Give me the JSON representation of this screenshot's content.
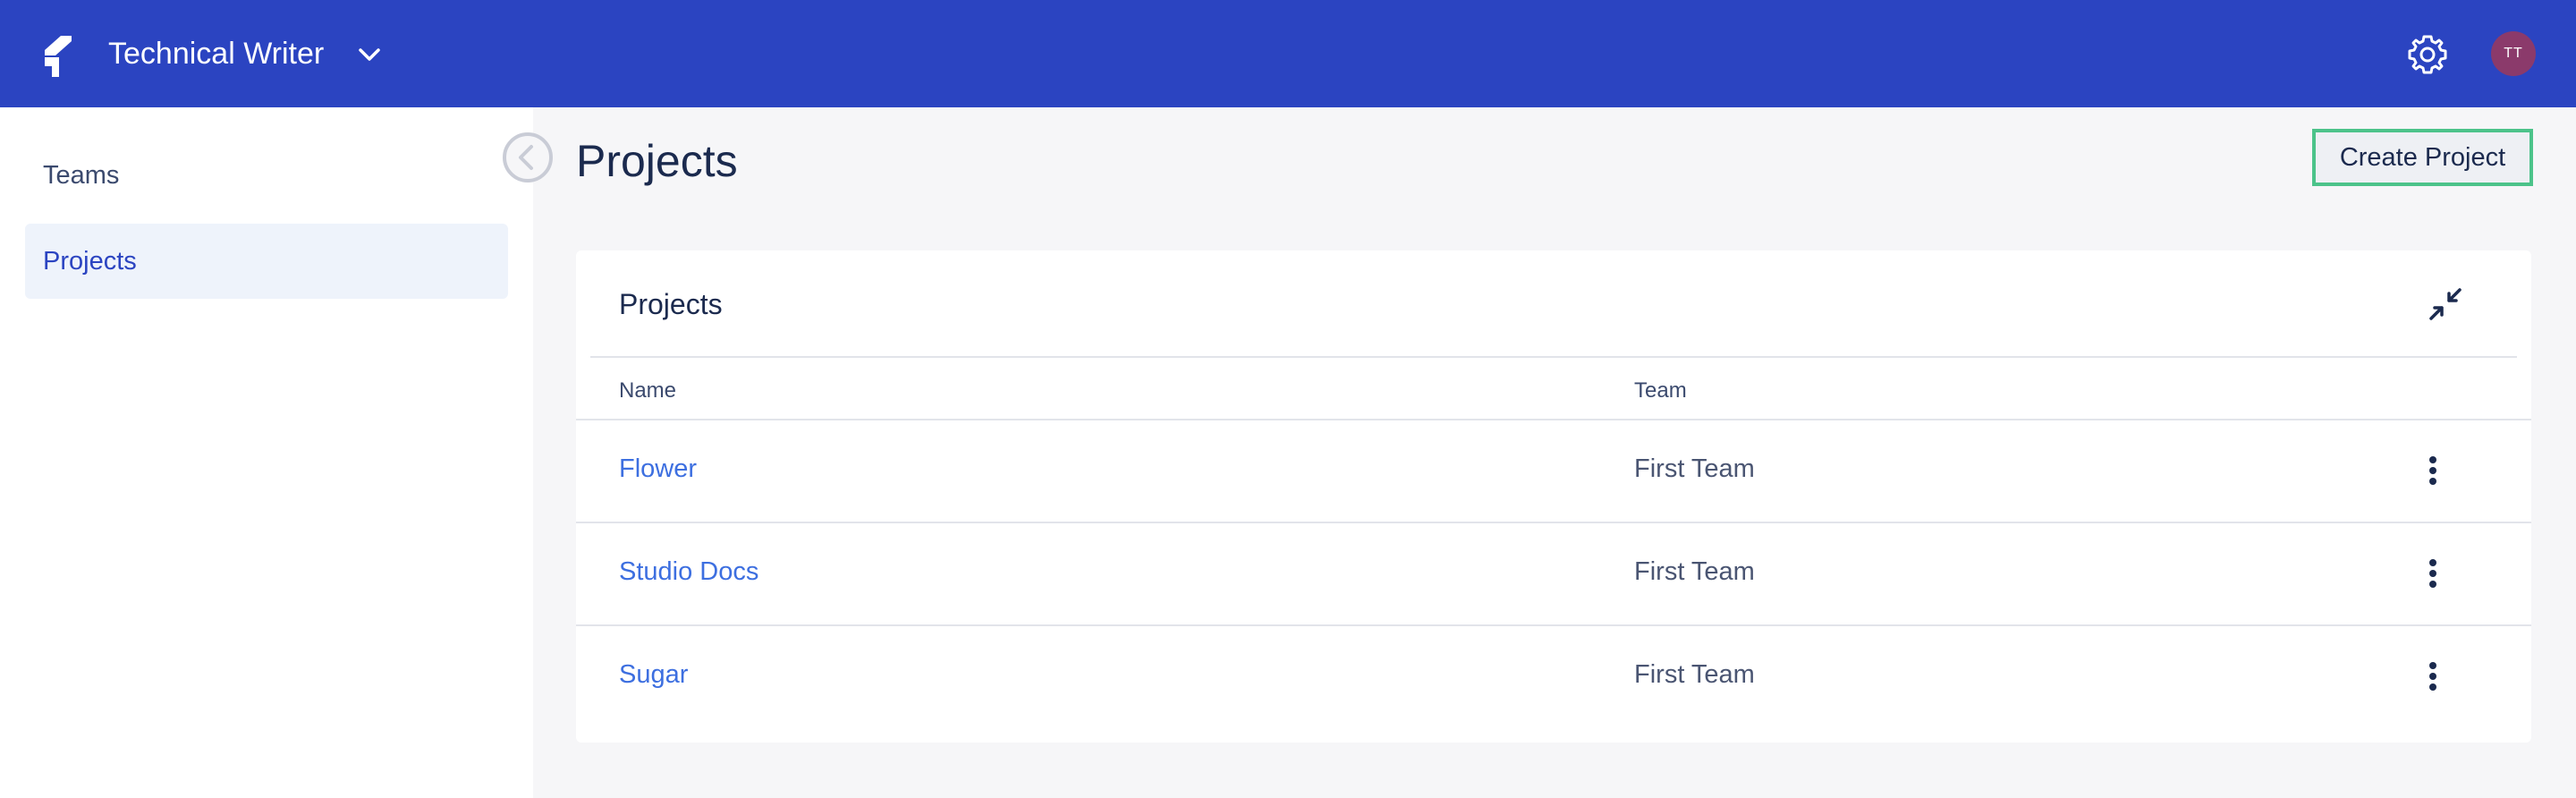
{
  "topbar": {
    "org_title": "Technical Writer",
    "avatar_initials": "TT",
    "icons": [
      "logo-icon",
      "chevron-down-icon",
      "gear-icon"
    ]
  },
  "sidebar": {
    "items": [
      {
        "label": "Teams",
        "active": false
      },
      {
        "label": "Projects",
        "active": true
      }
    ]
  },
  "main": {
    "page_title": "Projects",
    "create_button_label": "Create Project",
    "card": {
      "title": "Projects",
      "columns": [
        "Name",
        "Team"
      ],
      "rows": [
        {
          "name": "Flower",
          "team": "First Team"
        },
        {
          "name": "Studio Docs",
          "team": "First Team"
        },
        {
          "name": "Sugar",
          "team": "First Team"
        }
      ]
    }
  },
  "colors": {
    "brand": "#2b44c1",
    "link": "#3d6fe0",
    "accent_outline": "#4cc38a",
    "avatar_bg": "#8b3a6b"
  }
}
